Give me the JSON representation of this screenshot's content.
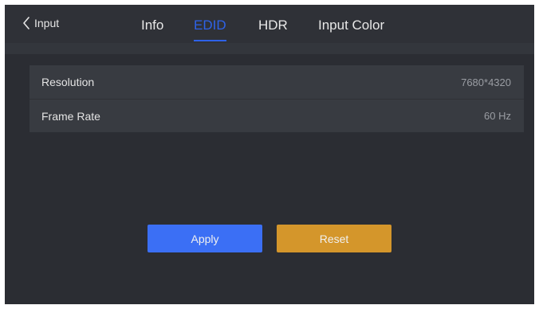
{
  "header": {
    "back_label": "Input",
    "tabs": [
      {
        "label": "Info",
        "active": false
      },
      {
        "label": "EDID",
        "active": true
      },
      {
        "label": "HDR",
        "active": false
      },
      {
        "label": "Input Color",
        "active": false
      }
    ]
  },
  "edid": {
    "rows": [
      {
        "label": "Resolution",
        "value": "7680*4320"
      },
      {
        "label": "Frame Rate",
        "value": "60 Hz"
      }
    ]
  },
  "actions": {
    "apply_label": "Apply",
    "reset_label": "Reset"
  },
  "colors": {
    "background": "#2b2d33",
    "header": "#2f3137",
    "panel": "#383b41",
    "active_tab": "#2e62e8",
    "apply": "#3b6ff5",
    "reset": "#d4962b"
  },
  "icons": {
    "back": "chevron-left-icon"
  }
}
